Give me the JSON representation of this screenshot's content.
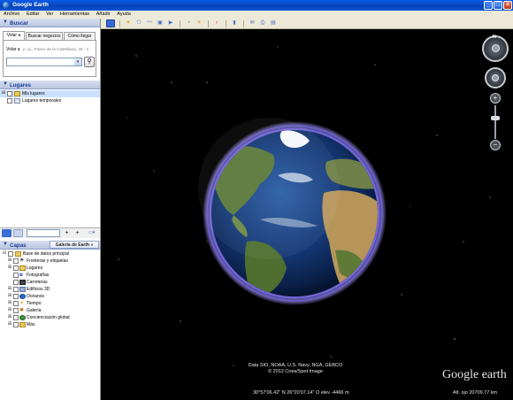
{
  "window": {
    "title": "Google Earth"
  },
  "menu": [
    "Archivo",
    "Editar",
    "Ver",
    "Herramientas",
    "Añadir",
    "Ayuda"
  ],
  "search": {
    "header": "Buscar",
    "tabs": [
      "Volar a",
      "Buscar negocios",
      "Cómo llegar"
    ],
    "fly_label": "Volar a",
    "fly_hint": "p. ej., Paseo de la Castellana, 30 - 2…"
  },
  "places": {
    "header": "Lugares",
    "items": [
      {
        "label": "Mis lugares"
      },
      {
        "label": "Lugares temporales"
      }
    ]
  },
  "layers": {
    "header": "Capas",
    "gallery_button": "Galería de Earth »",
    "items": [
      {
        "label": "Base de datos principal"
      },
      {
        "label": "Fronteras y etiquetas"
      },
      {
        "label": "Lugares"
      },
      {
        "label": "Fotografías"
      },
      {
        "label": "Carreteras"
      },
      {
        "label": "Edificios 3D"
      },
      {
        "label": "Océanos"
      },
      {
        "label": "Tiempo"
      },
      {
        "label": "Galería"
      },
      {
        "label": "Concienciación global"
      },
      {
        "label": "Más"
      }
    ]
  },
  "map": {
    "attribution_line1": "Data SIO, NOAA, U.S. Navy, NGA, GEBCO",
    "attribution_line2": "© 2012 Cnes/Spot Image",
    "status_coords": "30°57'06.42\" N  26°20'07.14\" O  elev  -4466 m",
    "eye_alt": "Alt. ojo 20709.77 km",
    "logo_text": "Google earth",
    "compass_letter": "N"
  },
  "colors": {
    "titlebar": "#0a5ce8",
    "panel_header": "#1a3f94",
    "selection": "#cde0ff"
  }
}
